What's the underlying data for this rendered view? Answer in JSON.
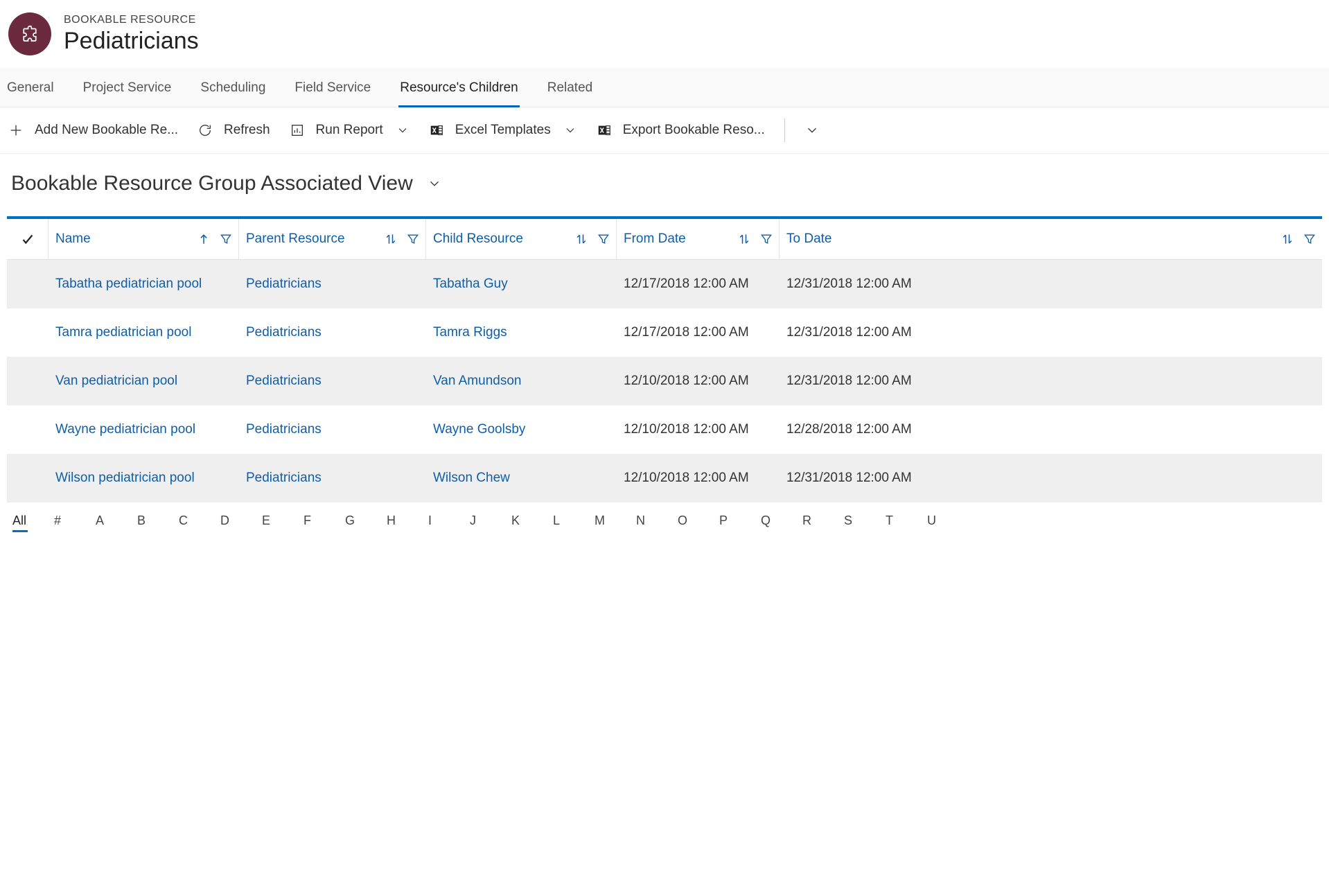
{
  "header": {
    "entity_type": "BOOKABLE RESOURCE",
    "entity_name": "Pediatricians"
  },
  "tabs": [
    {
      "label": "General",
      "active": false
    },
    {
      "label": "Project Service",
      "active": false
    },
    {
      "label": "Scheduling",
      "active": false
    },
    {
      "label": "Field Service",
      "active": false
    },
    {
      "label": "Resource's Children",
      "active": true
    },
    {
      "label": "Related",
      "active": false
    }
  ],
  "toolbar": {
    "add_new": "Add New Bookable Re...",
    "refresh": "Refresh",
    "run_report": "Run Report",
    "excel_templates": "Excel Templates",
    "export": "Export Bookable Reso..."
  },
  "view": {
    "title": "Bookable Resource Group Associated View"
  },
  "columns": {
    "name": "Name",
    "parent": "Parent Resource",
    "child": "Child Resource",
    "from": "From Date",
    "to": "To Date"
  },
  "rows": [
    {
      "name": "Tabatha pediatrician pool",
      "parent": "Pediatricians",
      "child": "Tabatha Guy",
      "from": "12/17/2018 12:00 AM",
      "to": "12/31/2018 12:00 AM"
    },
    {
      "name": "Tamra pediatrician pool",
      "parent": "Pediatricians",
      "child": "Tamra Riggs",
      "from": "12/17/2018 12:00 AM",
      "to": "12/31/2018 12:00 AM"
    },
    {
      "name": "Van pediatrician pool",
      "parent": "Pediatricians",
      "child": "Van Amundson",
      "from": "12/10/2018 12:00 AM",
      "to": "12/31/2018 12:00 AM"
    },
    {
      "name": "Wayne pediatrician pool",
      "parent": "Pediatricians",
      "child": "Wayne Goolsby",
      "from": "12/10/2018 12:00 AM",
      "to": "12/28/2018 12:00 AM"
    },
    {
      "name": "Wilson pediatrician pool",
      "parent": "Pediatricians",
      "child": "Wilson Chew",
      "from": "12/10/2018 12:00 AM",
      "to": "12/31/2018 12:00 AM"
    }
  ],
  "alpha": {
    "items": [
      "All",
      "#",
      "A",
      "B",
      "C",
      "D",
      "E",
      "F",
      "G",
      "H",
      "I",
      "J",
      "K",
      "L",
      "M",
      "N",
      "O",
      "P",
      "Q",
      "R",
      "S",
      "T",
      "U"
    ],
    "active": "All"
  }
}
